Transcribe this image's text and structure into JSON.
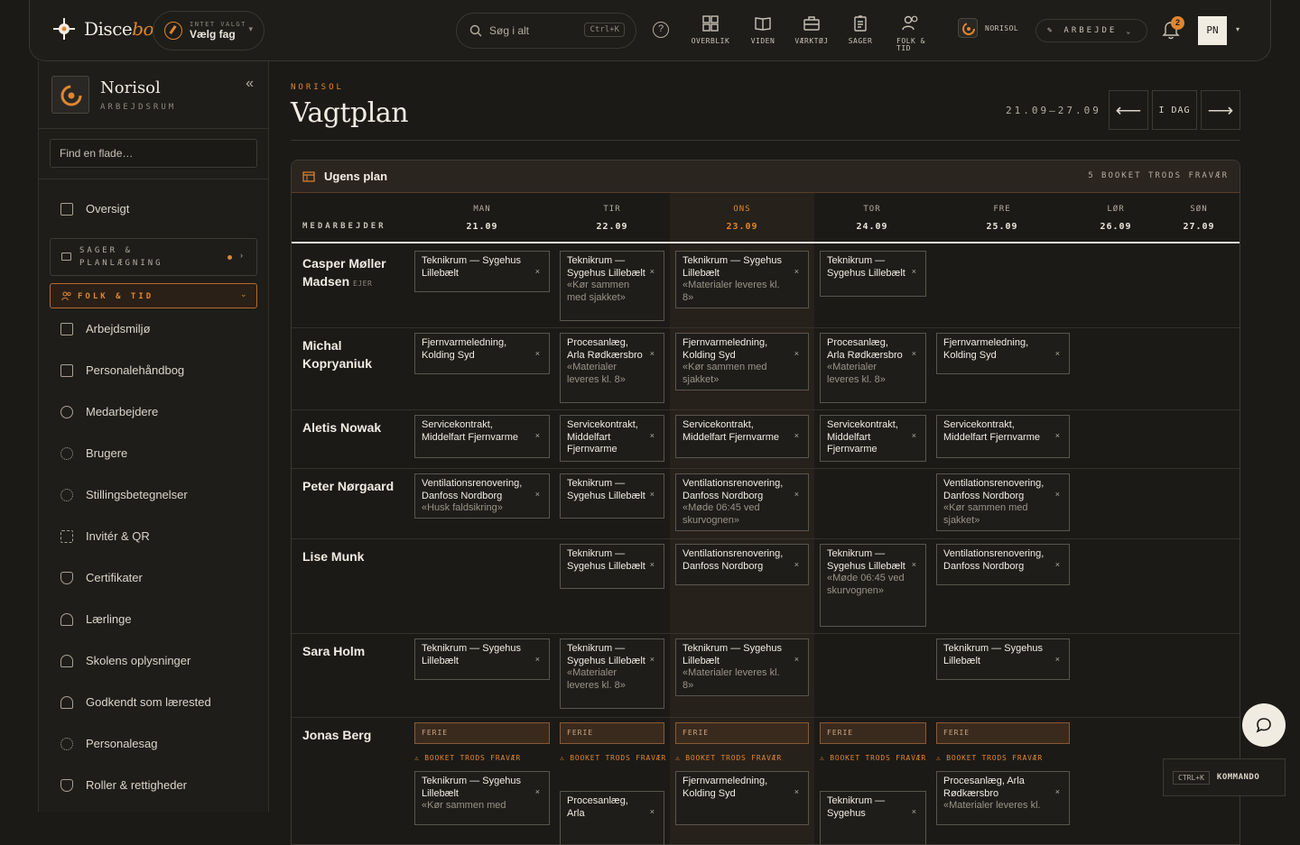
{
  "brand": {
    "name_main": "Disce",
    "name_accent": "bo"
  },
  "fag": {
    "small": "INTET VALGT",
    "label": "Vælg fag"
  },
  "search": {
    "placeholder": "Søg i alt",
    "shortcut": "Ctrl+K"
  },
  "nav": [
    {
      "label": "OVERBLIK",
      "icon": "grid-icon"
    },
    {
      "label": "VIDEN",
      "icon": "book-icon"
    },
    {
      "label": "VÆRKTØJ",
      "icon": "briefcase-icon"
    },
    {
      "label": "SAGER",
      "icon": "clipboard-icon"
    },
    {
      "label": "FOLK & TID",
      "icon": "people-icon"
    }
  ],
  "org_label": "NORISOL",
  "mode_label": "ARBEJDE",
  "notifications": "2",
  "user_initials": "PN",
  "sidebar": {
    "workspace_title": "Norisol",
    "workspace_sub": "ARBEJDSRUM",
    "find_placeholder": "Find en flade…",
    "overview": "Oversigt",
    "group_sager": "SAGER & PLANLÆGNING",
    "group_folk": "FOLK & TID",
    "items": [
      "Arbejdsmiljø",
      "Personalehåndbog",
      "Medarbejdere",
      "Brugere",
      "Stillingsbetegnelser",
      "Invitér & QR",
      "Certifikater",
      "Lærlinge",
      "Skolens oplysninger",
      "Godkendt som lærested",
      "Personalesag",
      "Roller & rettigheder"
    ]
  },
  "page": {
    "eyebrow": "NORISOL",
    "title": "Vagtplan",
    "range": "21.09–27.09",
    "today": "I DAG",
    "plan_title": "Ugens plan",
    "plan_note": "5 BOOKET TRODS FRAVÆR",
    "col_employees": "MEDARBEJDER",
    "highlight_color": "#e0862f"
  },
  "days": [
    {
      "d": "MAN",
      "n": "21.09"
    },
    {
      "d": "TIR",
      "n": "22.09"
    },
    {
      "d": "ONS",
      "n": "23.09"
    },
    {
      "d": "TOR",
      "n": "24.09"
    },
    {
      "d": "FRE",
      "n": "25.09"
    },
    {
      "d": "LØR",
      "n": "26.09"
    },
    {
      "d": "SØN",
      "n": "27.09"
    }
  ],
  "people": [
    {
      "name": "Casper Møller Madsen",
      "role": "EJER"
    },
    {
      "name": "Michal Kopryaniuk"
    },
    {
      "name": "Aletis Nowak"
    },
    {
      "name": "Peter Nørgaard"
    },
    {
      "name": "Lise Munk"
    },
    {
      "name": "Sara Holm"
    },
    {
      "name": "Jonas Berg"
    }
  ],
  "shifts": [
    {
      "p": 0,
      "day": 0,
      "title": "Teknikrum — Sygehus Lillebælt"
    },
    {
      "p": 0,
      "day": 1,
      "title": "Teknikrum — Sygehus Lillebælt",
      "note": "«Kør sammen med sjakket»"
    },
    {
      "p": 0,
      "day": 2,
      "title": "Teknikrum — Sygehus Lillebælt",
      "note": "«Materialer leveres kl. 8»"
    },
    {
      "p": 0,
      "day": 3,
      "title": "Teknikrum — Sygehus Lillebælt"
    },
    {
      "p": 1,
      "day": 0,
      "title": "Fjernvarmeledning, Kolding Syd"
    },
    {
      "p": 1,
      "day": 1,
      "title": "Procesanlæg, Arla Rødkærsbro",
      "note": "«Materialer leveres kl. 8»"
    },
    {
      "p": 1,
      "day": 2,
      "title": "Fjernvarmeledning, Kolding Syd",
      "note": "«Kør sammen med sjakket»"
    },
    {
      "p": 1,
      "day": 3,
      "title": "Procesanlæg, Arla Rødkærsbro",
      "note": "«Materialer leveres kl. 8»"
    },
    {
      "p": 1,
      "day": 4,
      "title": "Fjernvarmeledning, Kolding Syd"
    },
    {
      "p": 2,
      "day": 0,
      "title": "Servicekontrakt, Middelfart Fjernvarme"
    },
    {
      "p": 2,
      "day": 1,
      "title": "Servicekontrakt, Middelfart Fjernvarme"
    },
    {
      "p": 2,
      "day": 2,
      "title": "Servicekontrakt, Middelfart Fjernvarme"
    },
    {
      "p": 2,
      "day": 3,
      "title": "Servicekontrakt, Middelfart Fjernvarme"
    },
    {
      "p": 2,
      "day": 4,
      "title": "Servicekontrakt, Middelfart Fjernvarme"
    },
    {
      "p": 3,
      "day": 0,
      "title": "Ventilationsrenovering, Danfoss Nordborg",
      "note": "«Husk faldsikring»"
    },
    {
      "p": 3,
      "day": 1,
      "title": "Teknikrum — Sygehus Lillebælt"
    },
    {
      "p": 3,
      "day": 2,
      "title": "Ventilationsrenovering, Danfoss Nordborg",
      "note": "«Møde 06:45 ved skurvognen»"
    },
    {
      "p": 3,
      "day": 4,
      "title": "Ventilationsrenovering, Danfoss Nordborg",
      "note": "«Kør sammen med sjakket»"
    },
    {
      "p": 4,
      "day": 1,
      "title": "Teknikrum — Sygehus Lillebælt"
    },
    {
      "p": 4,
      "day": 2,
      "title": "Ventilationsrenovering, Danfoss Nordborg"
    },
    {
      "p": 4,
      "day": 3,
      "title": "Teknikrum — Sygehus Lillebælt",
      "note": "«Møde 06:45 ved skurvognen»"
    },
    {
      "p": 4,
      "day": 4,
      "title": "Ventilationsrenovering, Danfoss Nordborg"
    },
    {
      "p": 5,
      "day": 0,
      "title": "Teknikrum — Sygehus Lillebælt"
    },
    {
      "p": 5,
      "day": 1,
      "title": "Teknikrum — Sygehus Lillebælt",
      "note": "«Materialer leveres kl. 8»"
    },
    {
      "p": 5,
      "day": 2,
      "title": "Teknikrum — Sygehus Lillebælt",
      "note": "«Materialer leveres kl. 8»"
    },
    {
      "p": 5,
      "day": 4,
      "title": "Teknikrum — Sygehus Lillebælt"
    }
  ],
  "jonas": {
    "ferie": "FERIE",
    "warn": "⚠ BOOKET TRODS FRAVÆR",
    "shifts": [
      {
        "day": 0,
        "title": "Teknikrum — Sygehus Lillebælt",
        "note": "«Kør sammen med"
      },
      {
        "day": 1,
        "title": "Procesanlæg, Arla"
      },
      {
        "day": 2,
        "title": "Fjernvarmeledning, Kolding Syd"
      },
      {
        "day": 3,
        "title": "Teknikrum — Sygehus"
      },
      {
        "day": 4,
        "title": "Procesanlæg, Arla Rødkærsbro",
        "note": "«Materialer leveres kl."
      }
    ]
  },
  "command": {
    "key": "CTRL+K",
    "label": "KOMMANDO"
  }
}
